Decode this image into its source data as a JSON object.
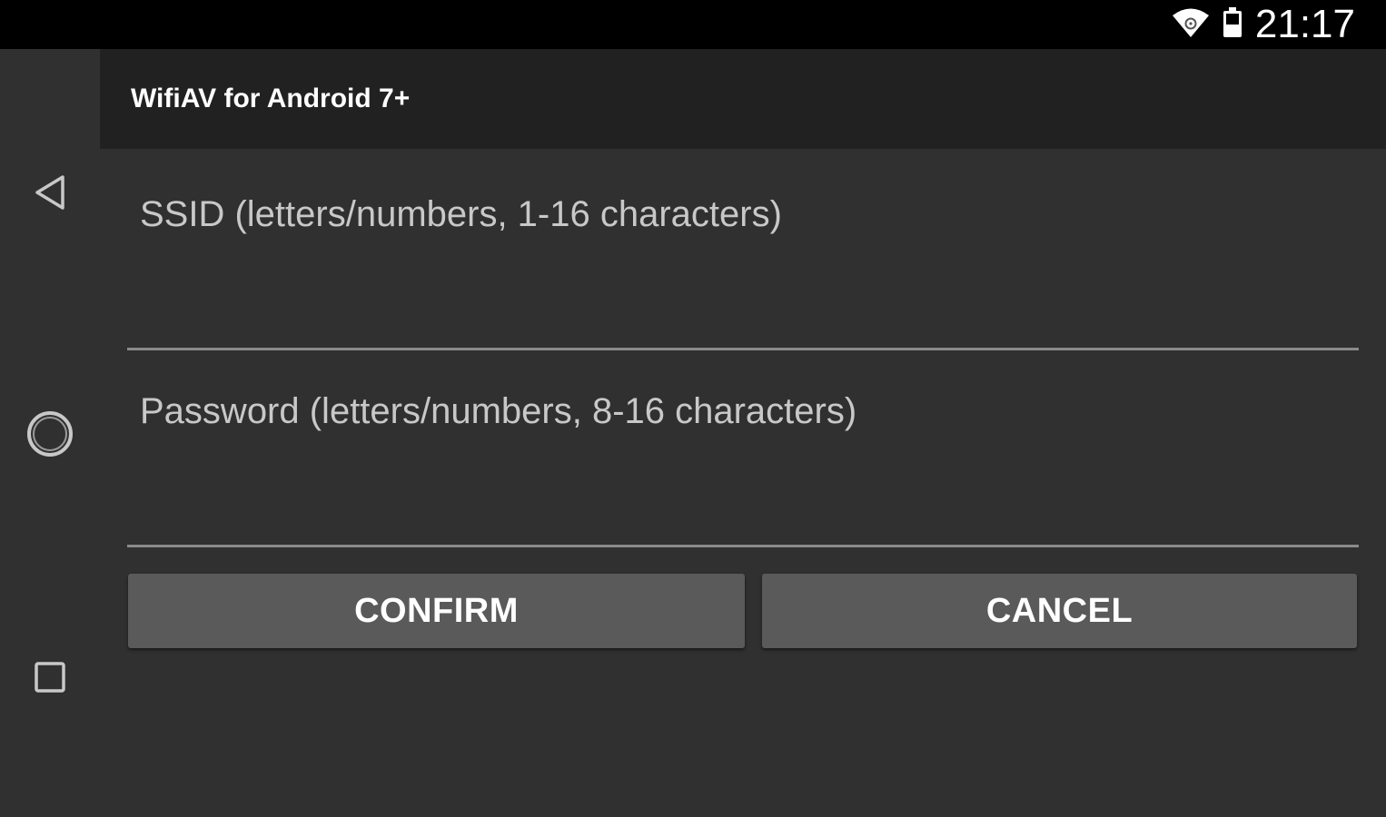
{
  "status_bar": {
    "time": "21:17",
    "icons": [
      "wifi-icon",
      "battery-icon"
    ]
  },
  "nav_bar": {
    "buttons": [
      "back-icon",
      "home-icon",
      "recents-icon"
    ]
  },
  "app": {
    "title": "WifiAV for Android 7+"
  },
  "form": {
    "ssid": {
      "value": "",
      "placeholder": "SSID (letters/numbers, 1-16 characters)"
    },
    "password": {
      "value": "",
      "placeholder": "Password (letters/numbers, 8-16 characters)"
    },
    "confirm_label": "CONFIRM",
    "cancel_label": "CANCEL"
  },
  "colors": {
    "status_bar": "#000000",
    "title_bar": "#212121",
    "background": "#303030",
    "button": "#5a5a5a",
    "underline": "#8a8a8a"
  }
}
